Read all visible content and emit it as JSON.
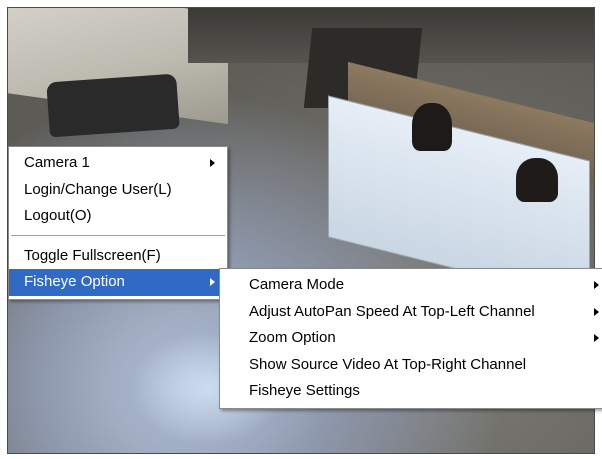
{
  "main_menu": {
    "items": [
      {
        "label": "Camera 1"
      },
      {
        "label": "Login/Change User(L)"
      },
      {
        "label": "Logout(O)"
      },
      {
        "label": "Toggle Fullscreen(F)"
      },
      {
        "label": "Fisheye Option"
      }
    ]
  },
  "fisheye_submenu": {
    "items": [
      {
        "label": "Camera Mode"
      },
      {
        "label": "Adjust AutoPan Speed At Top-Left Channel"
      },
      {
        "label": "Zoom Option"
      },
      {
        "label": "Show Source Video At Top-Right Channel"
      },
      {
        "label": "Fisheye Settings"
      }
    ]
  },
  "colors": {
    "highlight": "#316ac5",
    "menu_bg": "#ffffff"
  },
  "icons": [
    "submenu-arrow-icon"
  ]
}
